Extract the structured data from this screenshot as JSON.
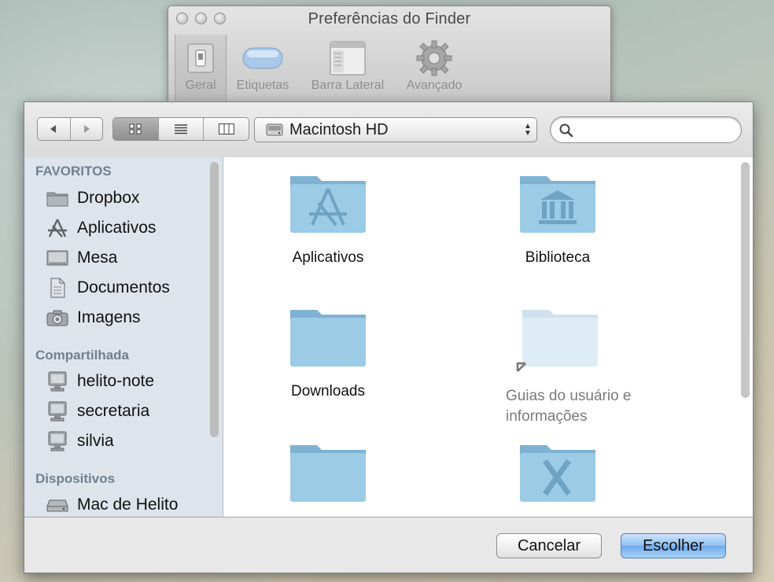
{
  "prefs_window": {
    "title": "Preferências do Finder",
    "tabs": [
      {
        "label": "Geral",
        "icon": "switch-icon"
      },
      {
        "label": "Etiquetas",
        "icon": "label-pill-icon"
      },
      {
        "label": "Barra Lateral",
        "icon": "sidebar-icon"
      },
      {
        "label": "Avançado",
        "icon": "gear-icon"
      }
    ],
    "selected_tab": "Geral"
  },
  "dialog": {
    "location": "Macintosh HD",
    "search_placeholder": "",
    "view_mode": "icon",
    "sidebar": {
      "sections": [
        {
          "header": "FAVORITOS",
          "items": [
            {
              "label": "Dropbox",
              "icon": "folder-icon"
            },
            {
              "label": "Aplicativos",
              "icon": "applications-icon"
            },
            {
              "label": "Mesa",
              "icon": "desktop-icon"
            },
            {
              "label": "Documentos",
              "icon": "document-icon"
            },
            {
              "label": "Imagens",
              "icon": "camera-icon"
            }
          ]
        },
        {
          "header": "Compartilhada",
          "items": [
            {
              "label": "helito-note",
              "icon": "computer-icon"
            },
            {
              "label": "secretaria",
              "icon": "computer-icon"
            },
            {
              "label": "silvia",
              "icon": "computer-icon"
            }
          ]
        },
        {
          "header": "Dispositivos",
          "items": [
            {
              "label": "Mac de Helito",
              "icon": "hard-drive-icon"
            }
          ]
        }
      ]
    },
    "files": [
      {
        "label": "Aplicativos",
        "icon": "applications-folder-icon",
        "disabled": false
      },
      {
        "label": "Biblioteca",
        "icon": "library-folder-icon",
        "disabled": false
      },
      {
        "label": "Downloads",
        "icon": "folder-icon",
        "disabled": false
      },
      {
        "label": "Guias do usuário e informações",
        "label_line1": "Guias do usuário e",
        "label_line2": "informações",
        "icon": "alias-folder-icon",
        "disabled": true
      },
      {
        "label": "",
        "icon": "folder-icon",
        "disabled": false
      },
      {
        "label": "",
        "icon": "system-folder-icon",
        "disabled": false
      }
    ],
    "buttons": {
      "cancel": "Cancelar",
      "choose": "Escolher"
    }
  },
  "colors": {
    "folder": "#8fc0dc",
    "sidebar_bg": "#dde4ec",
    "accent_button": "#7fb6ee",
    "section_header": "#70808f"
  }
}
